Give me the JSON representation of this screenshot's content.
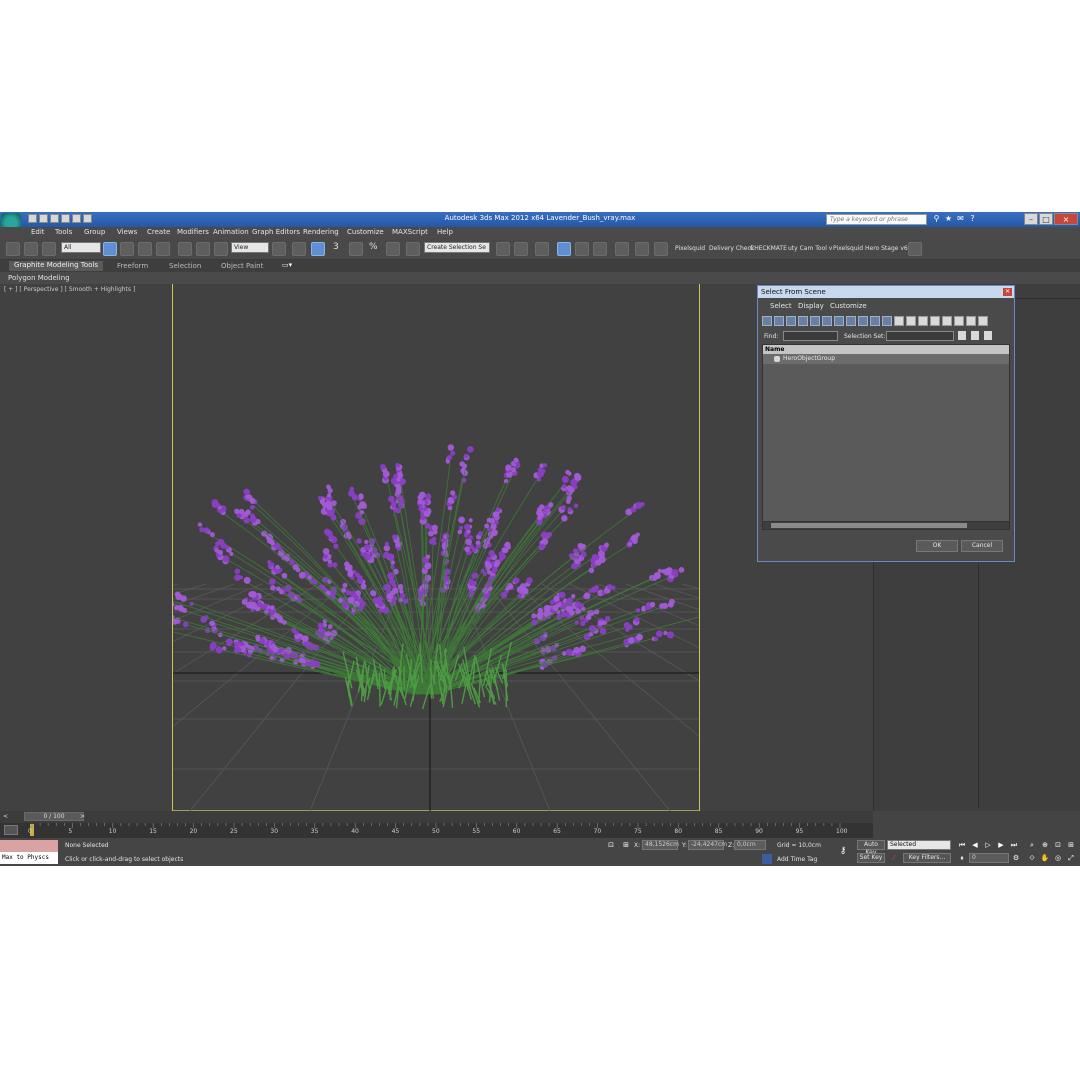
{
  "window": {
    "title": "Autodesk 3ds Max  2012 x64     Lavender_Bush_vray.max",
    "search_placeholder": "Type a keyword or phrase",
    "minimize": "–",
    "maximize": "□",
    "close": "×"
  },
  "menu": [
    "Edit",
    "Tools",
    "Group",
    "Views",
    "Create",
    "Modifiers",
    "Animation",
    "Graph Editors",
    "Rendering",
    "Customize",
    "MAXScript",
    "Help"
  ],
  "toolbar": {
    "filter_value": "All",
    "ref_coord_value": "View",
    "selection_set_value": "Create Selection Se",
    "snap_label": "3",
    "percent_label": "%",
    "plugins": [
      "Pixelsquid",
      "Delivery Check",
      "CHECKMATE",
      "uty Cam Tool v",
      "Pixelsquid",
      "Hero Stage v6"
    ]
  },
  "ribbon": {
    "tabs": [
      "Graphite Modeling Tools",
      "Freeform",
      "Selection",
      "Object Paint"
    ],
    "subtitle": "Polygon Modeling"
  },
  "viewport": {
    "label": "[ + ] [ Perspective ] [ Smooth + Highlights ]"
  },
  "dialog": {
    "title": "Select From Scene",
    "menu": [
      "Select",
      "Display",
      "Customize"
    ],
    "find_label": "Find:",
    "selection_set_label": "Selection Set:",
    "column_header": "Name",
    "items": [
      "HeroObjectGroup"
    ],
    "ok": "OK",
    "cancel": "Cancel"
  },
  "timeline": {
    "slider": "0 / 100",
    "ticks": [
      "0",
      "5",
      "10",
      "15",
      "20",
      "25",
      "30",
      "35",
      "40",
      "45",
      "50",
      "55",
      "60",
      "65",
      "70",
      "75",
      "80",
      "85",
      "90",
      "95",
      "100"
    ]
  },
  "status": {
    "maxscript": "Max to Physcs",
    "selection": "None Selected",
    "prompt": "Click or click-and-drag to select objects",
    "x_label": "X:",
    "x_value": "48,1526cm",
    "y_label": "Y:",
    "y_value": "-24,4247cm",
    "z_label": "Z:",
    "z_value": "0,0cm",
    "grid": "Grid = 10,0cm",
    "add_time_tag": "Add Time Tag",
    "auto_key": "Auto Key",
    "auto_key_value": "Selected",
    "set_key": "Set Key",
    "key_filters": "Key Filters...",
    "frame_value": "0"
  },
  "colors": {
    "title_bar": "#2457a8",
    "safe_frame": "#cfc75a",
    "lavender": "#8a3fc2",
    "stems": "#3f7a3a"
  }
}
